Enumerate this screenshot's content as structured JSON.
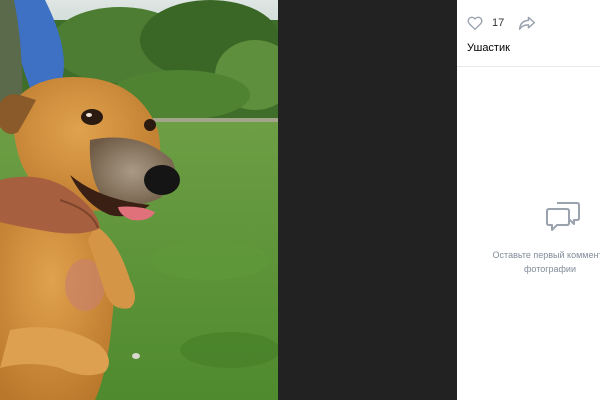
{
  "viewer": {
    "likes_count": "17",
    "owner_name": "Ушастик",
    "comments_empty_line1": "Оставьте первый коммента",
    "comments_empty_line2": "фотографии"
  },
  "icons": {
    "like": "heart-icon",
    "share": "share-arrow-icon",
    "comments": "speech-bubbles-icon"
  },
  "colors": {
    "panel_background": "#ffffff",
    "viewer_backdrop": "#222222",
    "secondary_text": "#818c99",
    "icon_gray": "#99a2ad"
  }
}
